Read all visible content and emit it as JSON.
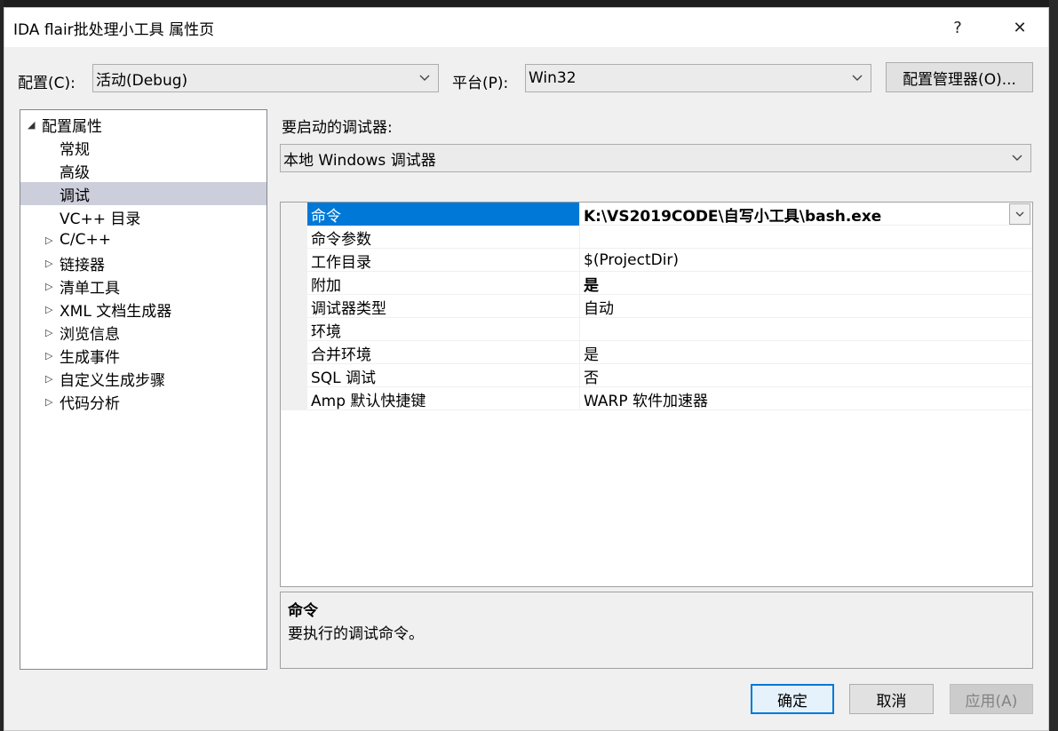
{
  "window": {
    "title": "IDA flair批处理小工具 属性页",
    "help_label": "?",
    "close_label": "✕"
  },
  "toolbar": {
    "config_label": "配置(C):",
    "config_value": "活动(Debug)",
    "platform_label": "平台(P):",
    "platform_value": "Win32",
    "config_manager_label": "配置管理器(O)..."
  },
  "tree": {
    "root": "配置属性",
    "items": [
      {
        "label": "常规",
        "expandable": false
      },
      {
        "label": "高级",
        "expandable": false
      },
      {
        "label": "调试",
        "expandable": false,
        "selected": true
      },
      {
        "label": "VC++ 目录",
        "expandable": false
      },
      {
        "label": "C/C++",
        "expandable": true
      },
      {
        "label": "链接器",
        "expandable": true
      },
      {
        "label": "清单工具",
        "expandable": true
      },
      {
        "label": "XML 文档生成器",
        "expandable": true
      },
      {
        "label": "浏览信息",
        "expandable": true
      },
      {
        "label": "生成事件",
        "expandable": true
      },
      {
        "label": "自定义生成步骤",
        "expandable": true
      },
      {
        "label": "代码分析",
        "expandable": true
      }
    ]
  },
  "debugger": {
    "label": "要启动的调试器:",
    "value": "本地 Windows 调试器"
  },
  "properties": [
    {
      "name": "命令",
      "value": "K:\\VS2019CODE\\自写小工具\\bash.exe",
      "bold": true,
      "selected": true
    },
    {
      "name": "命令参数",
      "value": ""
    },
    {
      "name": "工作目录",
      "value": "$(ProjectDir)"
    },
    {
      "name": "附加",
      "value": "是",
      "bold": true
    },
    {
      "name": "调试器类型",
      "value": "自动"
    },
    {
      "name": "环境",
      "value": ""
    },
    {
      "name": "合并环境",
      "value": "是"
    },
    {
      "name": "SQL 调试",
      "value": "否"
    },
    {
      "name": "Amp 默认快捷键",
      "value": "WARP 软件加速器"
    }
  ],
  "description": {
    "title": "命令",
    "text": "要执行的调试命令。"
  },
  "buttons": {
    "ok": "确定",
    "cancel": "取消",
    "apply": "应用(A)"
  },
  "colors": {
    "selection": "#0078d7",
    "tree_selection": "#cccedb",
    "dialog_bg": "#f0f0f0"
  }
}
